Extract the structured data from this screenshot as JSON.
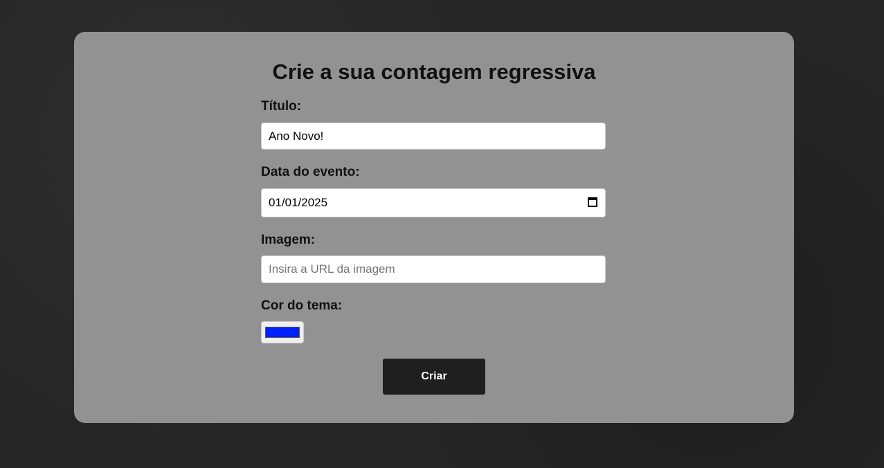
{
  "form": {
    "title": "Crie a sua contagem regressiva",
    "title_label": "Título:",
    "title_value": "Ano Novo!",
    "date_label": "Data do evento:",
    "date_value": "01/01/2025",
    "image_label": "Imagem:",
    "image_placeholder": "Insira a URL da imagem",
    "color_label": "Cor do tema:",
    "color_value": "#0022ff",
    "submit_label": "Criar"
  }
}
